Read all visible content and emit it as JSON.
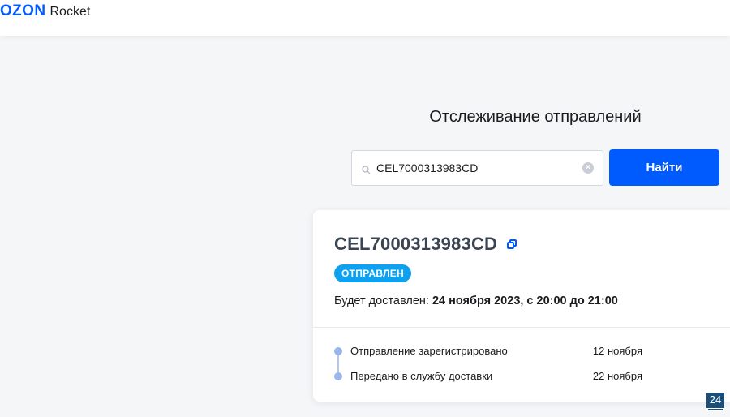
{
  "header": {
    "logo_ozon": "OZON",
    "logo_rocket": "Rocket"
  },
  "tracking": {
    "title": "Отслеживание отправлений",
    "search_value": "CEL7000313983CD",
    "find_label": "Найти"
  },
  "shipment": {
    "track_number": "CEL7000313983CD",
    "status": "ОТПРАВЛЕН",
    "status_color": "#10a0f0",
    "delivery_prefix": "Будет доставлен:",
    "delivery_value": "24 ноября 2023, с 20:00 до 21:00",
    "events": [
      {
        "label": "Отправление зарегистрировано",
        "date": "12 ноября"
      },
      {
        "label": "Передано в службу доставки",
        "date": "22 ноября"
      }
    ]
  },
  "overlay": {
    "corner_badge": "24"
  },
  "colors": {
    "accent": "#005bff",
    "background": "#f5f6f8"
  }
}
